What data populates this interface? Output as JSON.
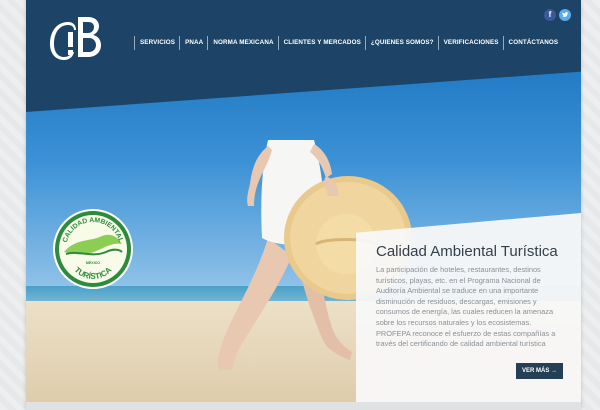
{
  "header": {
    "logo_text": "!B",
    "nav": [
      "SERVICIOS",
      "PNAA",
      "NORMA MEXICANA",
      "CLIENTES Y MERCADOS",
      "¿QUIENES SOMOS?",
      "VERIFICACIONES",
      "CONTÁCTANOS"
    ],
    "social": [
      {
        "name": "facebook",
        "glyph": "f",
        "color": "#3b5998"
      },
      {
        "name": "twitter",
        "glyph": "t",
        "color": "#55acee"
      }
    ]
  },
  "seal": {
    "top_text": "CALIDAD AMBIENTAL",
    "middle_text": "MÉXICO",
    "bottom_text": "TURÍSTICA"
  },
  "caption": {
    "title": "Calidad Ambiental Turística",
    "text": "La participación de hoteles, restaurantes, destinos turísticos, playas, etc. en el Programa Nacional de Auditoría Ambiental se traduce en una importante disminución de residuos, descargas, emisiones y consumos de energía, las cuales reducen la amenaza sobre los recursos naturales y los ecosistemas. PROFEPA reconoce el esfuerzo de estas compañías a través del certificando de calidad ambiental turística",
    "button": "VER MÁS",
    "button_icon": "arrow-right-icon"
  },
  "colors": {
    "header": "#1d4466",
    "button": "#253f56",
    "title": "#333f4b",
    "text": "#8b9096"
  }
}
